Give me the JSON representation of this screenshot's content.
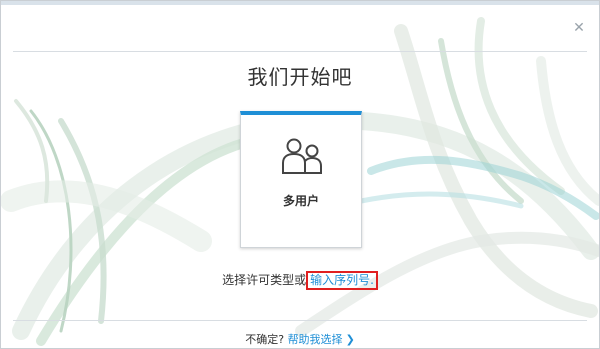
{
  "dialog": {
    "close_icon": "close-icon",
    "title": "我们开始吧"
  },
  "license_card": {
    "icon": "users-icon",
    "label": "多用户",
    "accent_color": "#1f8fd6"
  },
  "license_line": {
    "prefix": "选择许可类型或",
    "serial_link": "输入序列号",
    "suffix": "."
  },
  "help": {
    "prefix": "不确定?",
    "link": "帮助我选择",
    "chevron_icon": "chevron-right-icon"
  }
}
